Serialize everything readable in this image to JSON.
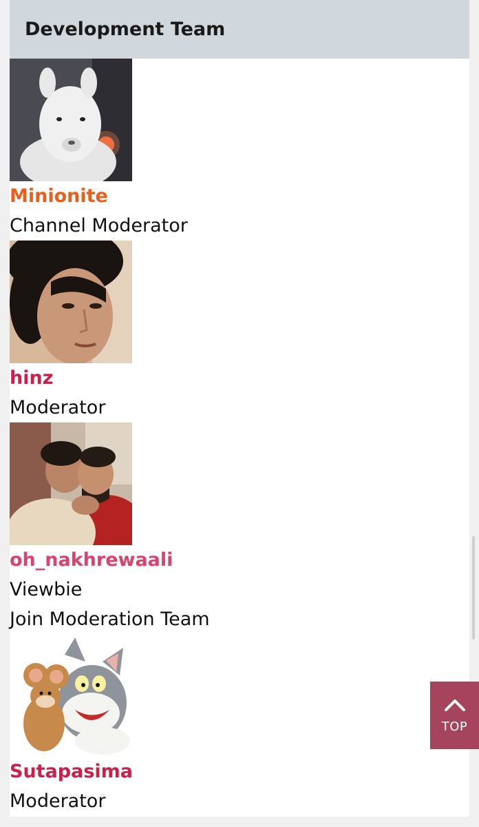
{
  "panel": {
    "title": "Development Team"
  },
  "members": [
    {
      "name": "Minionite",
      "role": "Channel Moderator",
      "name_color": "#e8601c",
      "avatar_icon": "alpaca-photo"
    },
    {
      "name": "hinz",
      "role": "Moderator",
      "name_color": "#cc1f4a",
      "avatar_icon": "portrait-photo"
    },
    {
      "name": "oh_nakhrewaali",
      "role": "Viewbie",
      "name_color": "#d94370",
      "avatar_icon": "couple-photo",
      "extra_link": "Join Moderation Team"
    },
    {
      "name": "Sutapasima",
      "role": "Moderator",
      "name_color": "#cc1f4a",
      "avatar_icon": "cartoon-cat-mouse-image"
    }
  ],
  "top_button": {
    "label": "TOP",
    "icon": "chevron-up-icon",
    "color": "#a5445c"
  }
}
